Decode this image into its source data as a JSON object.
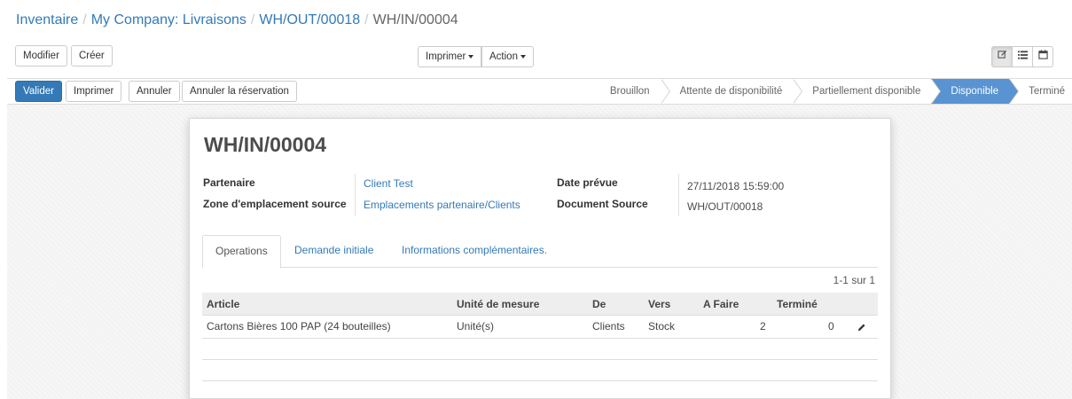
{
  "breadcrumb": {
    "items": [
      "Inventaire",
      "My Company: Livraisons",
      "WH/OUT/00018"
    ],
    "current": "WH/IN/00004",
    "separator": "/"
  },
  "toolbar": {
    "edit_label": "Modifier",
    "create_label": "Créer",
    "print_label": "Imprimer",
    "action_label": "Action"
  },
  "actions": {
    "validate_label": "Valider",
    "print_label": "Imprimer",
    "cancel_label": "Annuler",
    "cancel_reservation_label": "Annuler la réservation"
  },
  "status": {
    "steps": [
      "Brouillon",
      "Attente de disponibilité",
      "Partiellement disponible",
      "Disponible",
      "Terminé"
    ],
    "active": "Disponible"
  },
  "record": {
    "title": "WH/IN/00004",
    "partner_label": "Partenaire",
    "partner_value": "Client Test",
    "source_zone_label": "Zone d'emplacement source",
    "source_zone_value": "Emplacements partenaire/Clients",
    "scheduled_date_label": "Date prévue",
    "scheduled_date_value": "27/11/2018 15:59:00",
    "source_document_label": "Document Source",
    "source_document_value": "WH/OUT/00018"
  },
  "tabs": [
    "Operations",
    "Demande initiale",
    "Informations complémentaires."
  ],
  "pager": "1-1 sur 1",
  "table": {
    "columns": [
      "Article",
      "Unité de mesure",
      "De",
      "Vers",
      "A Faire",
      "Terminé"
    ],
    "rows": [
      [
        "Cartons Bières 100 PAP (24 bouteilles)",
        "Unité(s)",
        "Clients",
        "Stock",
        "2",
        "0"
      ]
    ]
  },
  "colors": {
    "primary": "#337ab7",
    "status_active": "#5a93d1",
    "header_bg": "#eeeeee"
  },
  "icons": [
    "pencil-icon",
    "edit-view-icon",
    "list-view-icon",
    "calendar-view-icon"
  ]
}
